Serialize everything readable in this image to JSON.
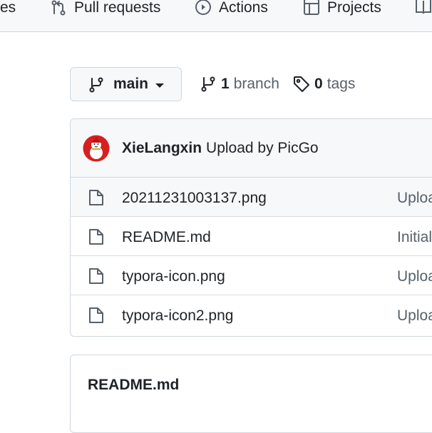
{
  "topnav": {
    "items": [
      {
        "label": "es",
        "icon": "none"
      },
      {
        "label": "Pull requests",
        "icon": "git-pull-request-icon"
      },
      {
        "label": "Actions",
        "icon": "play-icon"
      },
      {
        "label": "Projects",
        "icon": "table-icon"
      }
    ]
  },
  "branch_selector": {
    "label": "main"
  },
  "branches": {
    "count": "1",
    "label": "branch"
  },
  "tags": {
    "count": "0",
    "label": "tags"
  },
  "commit": {
    "author": "XieLangxin",
    "message": "Upload by PicGo"
  },
  "files": [
    {
      "name": "20211231003137.png",
      "message": "Uploa"
    },
    {
      "name": "README.md",
      "message": "Initial"
    },
    {
      "name": "typora-icon.png",
      "message": "Uploa"
    },
    {
      "name": "typora-icon2.png",
      "message": "Uploa"
    }
  ],
  "readme": {
    "title": "README.md"
  },
  "colors": {
    "accent": "#1f2328",
    "muted": "#57606a",
    "border": "#d0d7de",
    "subtle_bg": "#f6f8fa"
  }
}
